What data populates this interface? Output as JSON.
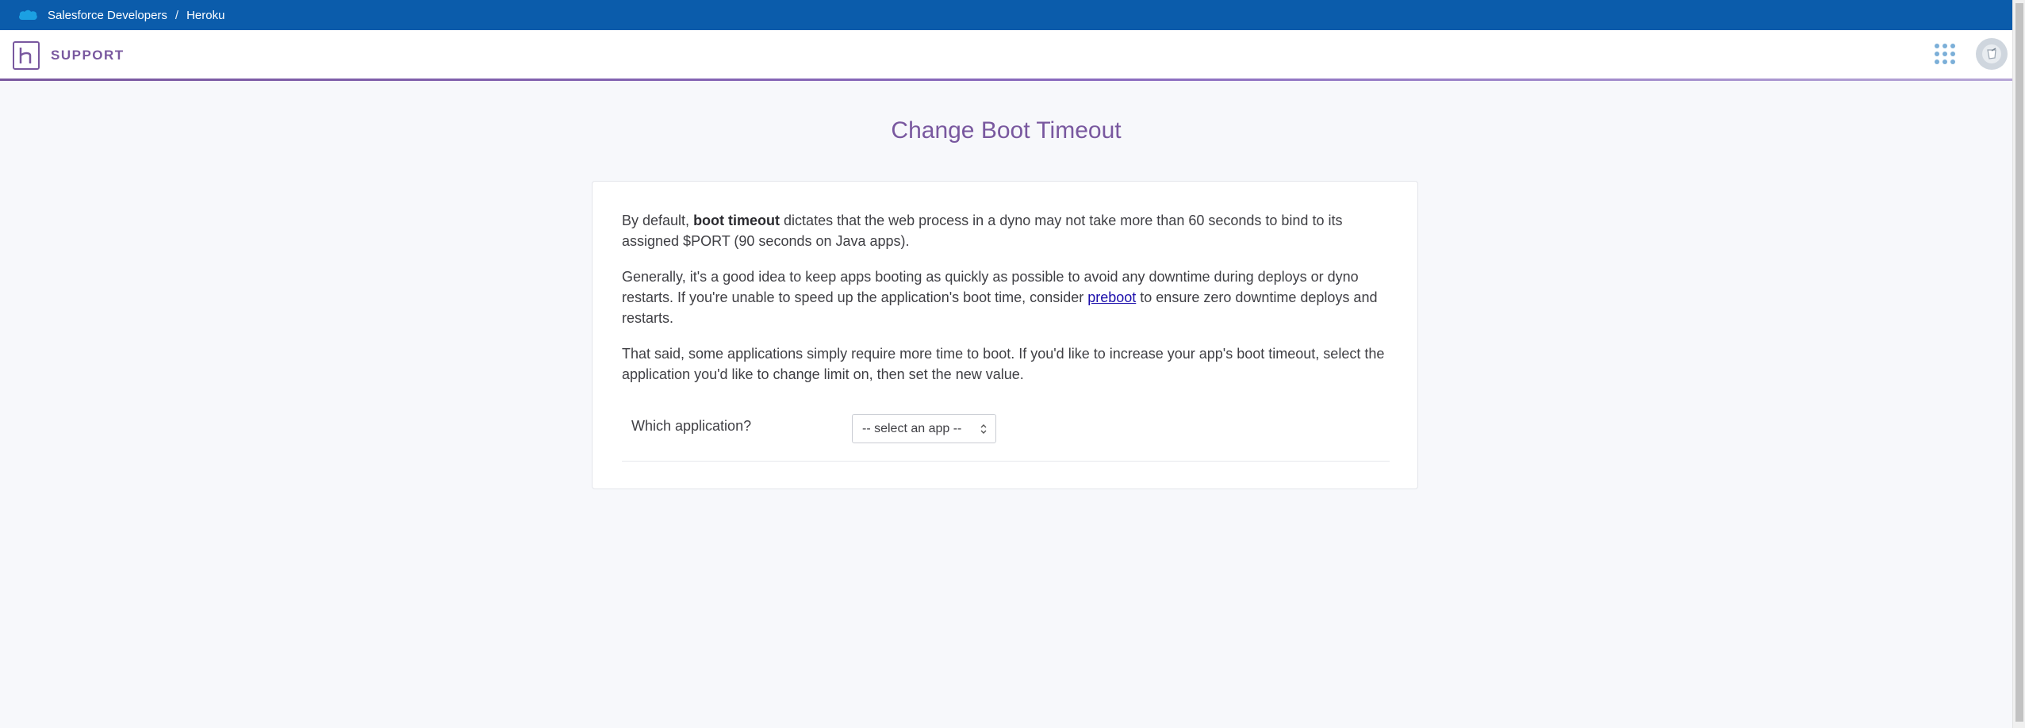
{
  "topbar": {
    "brand": "Salesforce Developers",
    "separator": "/",
    "current": "Heroku"
  },
  "header": {
    "section_label": "SUPPORT",
    "logo_letter": "H"
  },
  "page": {
    "title": "Change Boot Timeout"
  },
  "content": {
    "p1_before": "By default, ",
    "p1_bold": "boot timeout",
    "p1_after": " dictates that the web process in a dyno may not take more than 60 seconds to bind to its assigned $PORT (90 seconds on Java apps).",
    "p2_before": "Generally, it's a good idea to keep apps booting as quickly as possible to avoid any downtime during deploys or dyno restarts. If you're unable to speed up the application's boot time, consider ",
    "p2_link": "preboot",
    "p2_after": " to ensure zero downtime deploys and restarts.",
    "p3": "That said, some applications simply require more time to boot. If you'd like to increase your app's boot timeout, select the application you'd like to change limit on, then set the new value."
  },
  "form": {
    "app_label": "Which application?",
    "app_select_value": "-- select an app --"
  },
  "colors": {
    "salesforce_blue": "#0b5cab",
    "heroku_purple": "#79589f",
    "link_blue": "#1a0dab"
  },
  "icons": {
    "brand": "salesforce-cloud-icon",
    "logo": "heroku-logo-icon",
    "apps": "apps-grid-icon",
    "avatar": "user-avatar-icon",
    "select": "updown-chevron-icon"
  }
}
